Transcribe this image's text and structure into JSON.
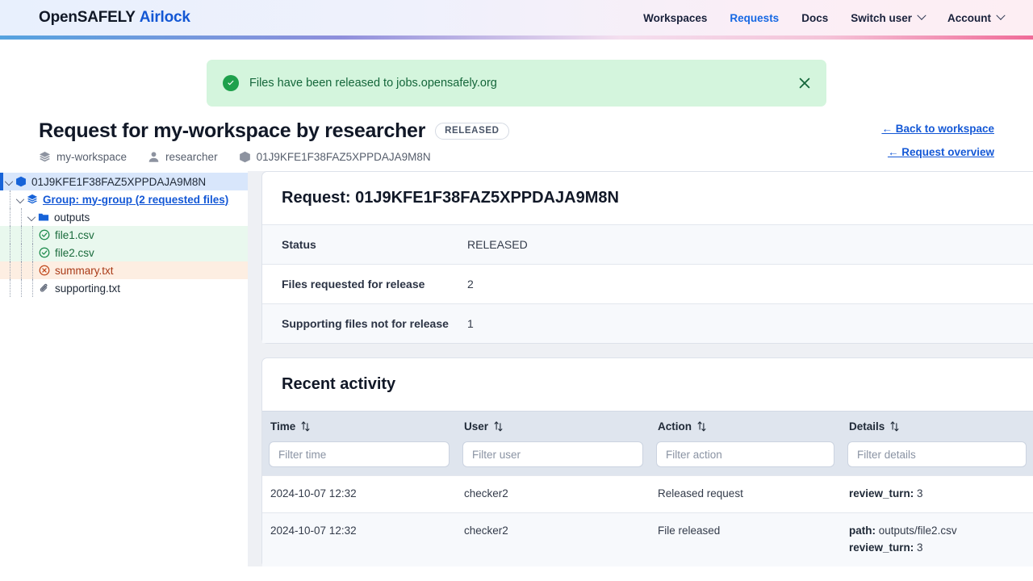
{
  "navbar": {
    "brand_primary": "OpenSAFELY",
    "brand_secondary": "Airlock",
    "links": [
      {
        "label": "Workspaces",
        "active": false,
        "caret": false
      },
      {
        "label": "Requests",
        "active": true,
        "caret": false
      },
      {
        "label": "Docs",
        "active": false,
        "caret": false
      },
      {
        "label": "Switch user",
        "active": false,
        "caret": true
      },
      {
        "label": "Account",
        "active": false,
        "caret": true
      }
    ]
  },
  "alert": {
    "message": "Files have been released to jobs.opensafely.org",
    "icon": "check-circle-icon",
    "close_icon": "close-icon",
    "background": "#d4f5dd",
    "accent": "#1fa04c"
  },
  "page_header": {
    "title": "Request for my-workspace by researcher",
    "status_badge": "RELEASED",
    "meta": [
      {
        "icon": "layers-icon",
        "label": "my-workspace"
      },
      {
        "icon": "user-icon",
        "label": "researcher"
      },
      {
        "icon": "box-icon",
        "label": "01J9KFE1F38FAZ5XPPDAJA9M8N"
      }
    ],
    "links": [
      {
        "label": "← Back to workspace"
      },
      {
        "label": "← Request overview"
      }
    ]
  },
  "sidebar": {
    "tree": [
      {
        "label": "01J9KFE1F38FAZ5XPPDAJA9M8N",
        "icon": "box-icon",
        "depth": 0,
        "state": "root",
        "expanded": true,
        "link": false
      },
      {
        "label": "Group: my-group (2 requested files)",
        "icon": "layers-icon",
        "depth": 1,
        "state": "none",
        "expanded": true,
        "link": true
      },
      {
        "label": "outputs",
        "icon": "folder-icon",
        "depth": 2,
        "state": "none",
        "expanded": true,
        "link": false
      },
      {
        "label": "file1.csv",
        "icon": "check-circle-icon",
        "depth": 3,
        "state": "ok",
        "expanded": null,
        "link": false
      },
      {
        "label": "file2.csv",
        "icon": "check-circle-icon",
        "depth": 3,
        "state": "ok",
        "expanded": null,
        "link": false
      },
      {
        "label": "summary.txt",
        "icon": "x-circle-icon",
        "depth": 3,
        "state": "bad",
        "expanded": null,
        "link": false
      },
      {
        "label": "supporting.txt",
        "icon": "paperclip-icon",
        "depth": 3,
        "state": "none",
        "expanded": null,
        "link": false
      }
    ]
  },
  "request_card": {
    "title": "Request: 01J9KFE1F38FAZ5XPPDAJA9M8N",
    "rows": [
      {
        "key": "Status",
        "value": "RELEASED"
      },
      {
        "key": "Files requested for release",
        "value": "2"
      },
      {
        "key": "Supporting files not for release",
        "value": "1"
      }
    ]
  },
  "activity_card": {
    "title": "Recent activity",
    "columns": [
      {
        "label": "Time",
        "placeholder": "Filter time",
        "sort_icon": "sort-icon"
      },
      {
        "label": "User",
        "placeholder": "Filter user",
        "sort_icon": "sort-icon"
      },
      {
        "label": "Action",
        "placeholder": "Filter action",
        "sort_icon": "sort-icon"
      },
      {
        "label": "Details",
        "placeholder": "Filter details",
        "sort_icon": "sort-icon"
      }
    ],
    "rows": [
      {
        "time": "2024-10-07 12:32",
        "user": "checker2",
        "action": "Released request",
        "details": [
          {
            "key": "review_turn:",
            "value": "3"
          }
        ]
      },
      {
        "time": "2024-10-07 12:32",
        "user": "checker2",
        "action": "File released",
        "details": [
          {
            "key": "path:",
            "value": "outputs/file2.csv"
          },
          {
            "key": "review_turn:",
            "value": "3"
          }
        ]
      }
    ]
  }
}
